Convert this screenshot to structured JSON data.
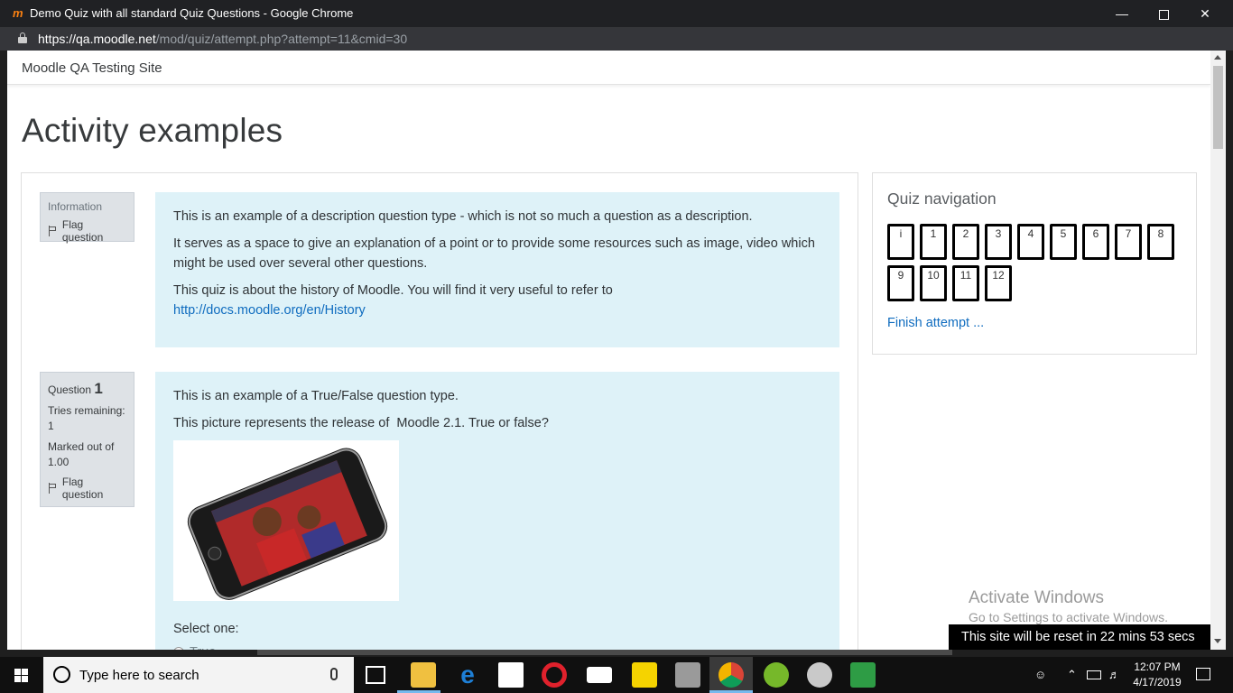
{
  "window": {
    "title": "Demo Quiz with all standard Quiz Questions - Google Chrome",
    "favicon_letter": "m"
  },
  "address": {
    "host": "https://qa.moodle.net",
    "path": "/mod/quiz/attempt.php?attempt=11&cmid=30"
  },
  "site": {
    "brand": "Moodle QA Testing Site",
    "heading": "Activity examples"
  },
  "info_block": {
    "label": "Information",
    "flag_label": "Flag question",
    "content": {
      "p1": "This is an example of a description question type - which is not so much a question as a description.",
      "p2": "It serves as a space to give an explanation of a point or to provide some resources such as image, video which might be used over several other questions.",
      "p3_text": "This quiz is about the history of Moodle. You will find it very useful to refer to",
      "p3_link": "http://docs.moodle.org/en/History"
    }
  },
  "question1": {
    "label": "Question",
    "number": "1",
    "tries_label": "Tries remaining:",
    "tries_value": "1",
    "marked_label": "Marked out of",
    "marked_value": "1.00",
    "flag_label": "Flag question",
    "content": {
      "p1": "This is an example of a True/False question type.",
      "p2": "This picture represents the release of  Moodle 2.1. True or false?",
      "select_label": "Select one:",
      "option_true": "True"
    }
  },
  "quiz_nav": {
    "title": "Quiz navigation",
    "buttons": [
      "i",
      "1",
      "2",
      "3",
      "4",
      "5",
      "6",
      "7",
      "8",
      "9",
      "10",
      "11",
      "12"
    ],
    "finish": "Finish attempt ..."
  },
  "watermark": {
    "line1": "Activate Windows",
    "line2": "Go to Settings to activate Windows."
  },
  "reset_banner": "This site will be reset in 22 mins 53 secs",
  "taskbar": {
    "search_placeholder": "Type here to search",
    "time": "12:07 PM",
    "date": "4/17/2019",
    "icons": [
      "task-view-icon",
      "file-explorer-icon",
      "edge-icon",
      "store-icon",
      "opera-icon",
      "mail-icon",
      "sticky-notes-icon",
      "app-icon",
      "chrome-icon",
      "utorrent-icon",
      "paint-icon",
      "spreadsheet-icon"
    ]
  },
  "colors": {
    "accent_link": "#0f6cbf",
    "question_bg": "#def2f8",
    "info_bg": "#dee2e6"
  }
}
